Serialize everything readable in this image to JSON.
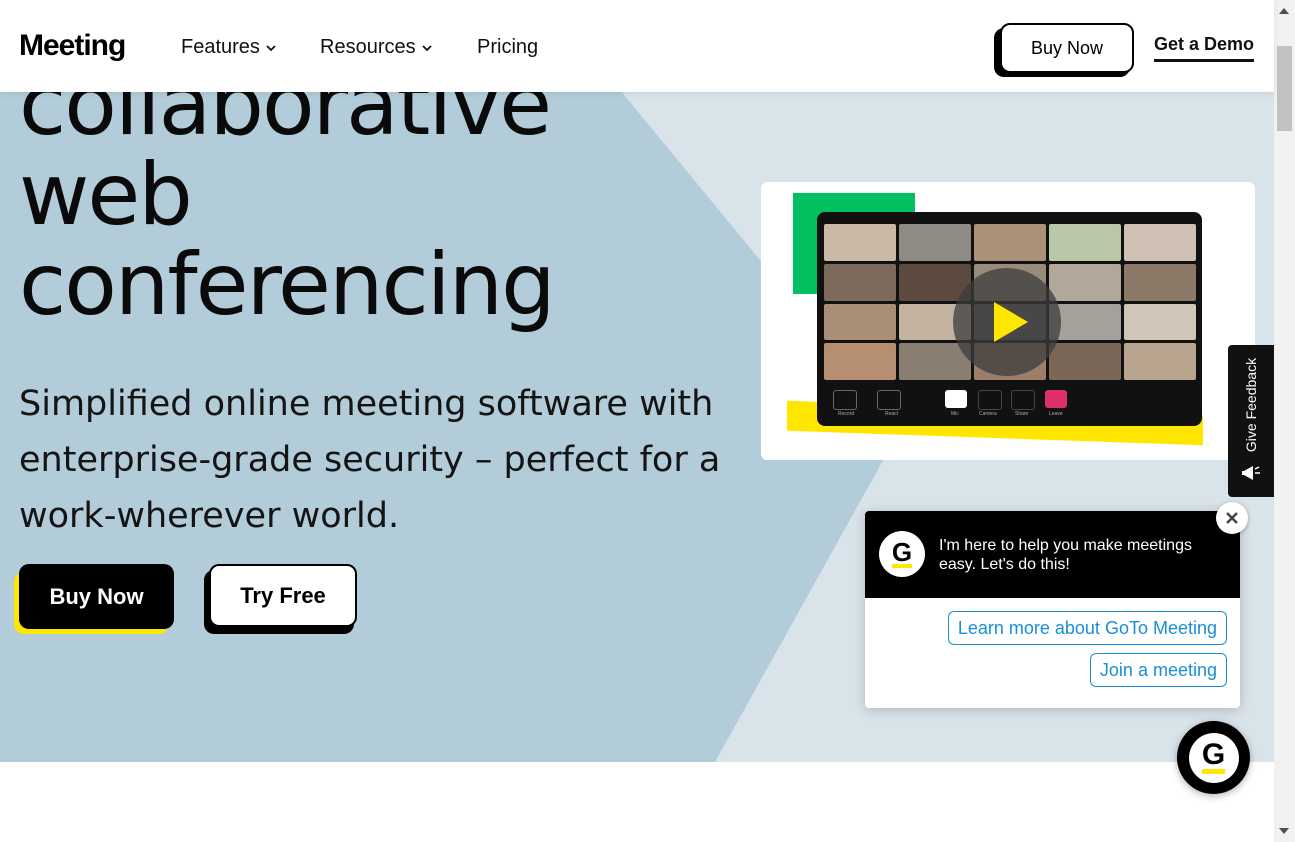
{
  "header": {
    "logo": "Meeting",
    "nav": [
      {
        "label": "Features",
        "has_dropdown": true
      },
      {
        "label": "Resources",
        "has_dropdown": true
      },
      {
        "label": "Pricing",
        "has_dropdown": false
      }
    ],
    "buy_now": "Buy Now",
    "get_demo": "Get a Demo"
  },
  "hero": {
    "title_lines": [
      "collaborative",
      "web",
      "conferencing"
    ],
    "subtitle": "Simplified online meeting software with enterprise-grade security – perfect for a work-wherever world.",
    "buy_now": "Buy Now",
    "try_free": "Try Free"
  },
  "video": {
    "play_icon": "play-icon",
    "controls": [
      "Record",
      "React",
      "Mic",
      "Camera",
      "Share",
      "Leave"
    ]
  },
  "feedback": {
    "label": "Give Feedback",
    "icon": "megaphone-icon"
  },
  "chat": {
    "avatar_letter": "G",
    "message": "I'm here to help you make meetings easy. Let's do this!",
    "options": [
      "Learn more about GoTo Meeting",
      "Join a meeting"
    ],
    "close_icon": "close-icon",
    "launcher_letter": "G"
  },
  "colors": {
    "accent_yellow": "#ffe600",
    "accent_green": "#00c060",
    "hero_bg": "#d9e3ea",
    "hero_shape": "#b3ccd9",
    "link_blue": "#1a8fd6"
  }
}
